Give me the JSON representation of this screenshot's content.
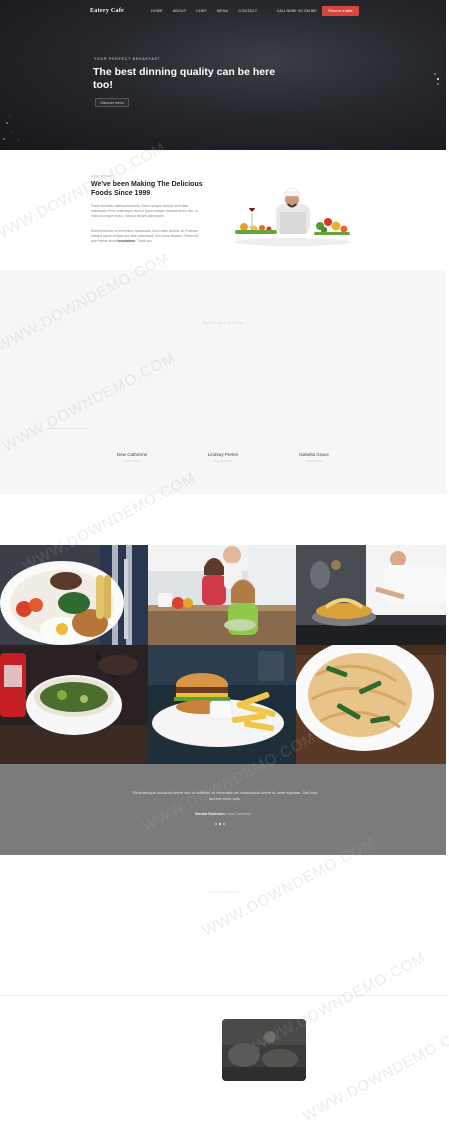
{
  "nav": {
    "logo": "Eatery Cafe",
    "items": [
      "HOME",
      "ABOUT",
      "CHEF",
      "MENU",
      "CONTACT"
    ],
    "call": "CALL NOW! +01 234 567",
    "reserve_label": "Reserve a table"
  },
  "hero": {
    "kicker": "YOUR PERFECT BREAKFAST",
    "title": "The best dinning quality can be here too!",
    "button_label": "Discover menu"
  },
  "about": {
    "kicker": "OUR STORY",
    "title": "We've been Making The Delicious Foods Since 1999",
    "paragraph_1": "Fusce hendrerit malesuada lacinia. Donec semper semper sem vitae malesuada. Proin scelerisque risus et ipsum semper molestie sed in nisi. Ut rhoncus congue lectus, rhoncus dictum ullamcorper.",
    "paragraph_2": "Sed elementum an fermentum malesuada. Nunc ullam at dolor sit. Praesent tristique sapien tempus sed felis scelerisque. Vel cursus aliquam. Please tell your friends about",
    "brand_link": "templatemo",
    "paragraph_end": ". Thank you."
  },
  "team": {
    "heading": "Meet our chefs",
    "members": [
      {
        "name": "New Catherine",
        "role": "Sushi Chef"
      },
      {
        "name": "Lindsay Perlen",
        "role": "Pastry Chef"
      },
      {
        "name": "Isabella Grace",
        "role": "Head Chef"
      }
    ]
  },
  "testimonial": {
    "quote": "Pellentesque tincidunt lorem sed ut eleifend at venenatis vel malesuada lorem id, ante egestas. Sed sed laoreet dolor quis.",
    "author": "Sandra Robinson",
    "author_role": "Loyal Customer"
  },
  "lower": {
    "kicker": "OUR LATEST"
  },
  "watermark": "WWW.DOWNDEMO.COM",
  "colors": {
    "accent": "#d6463f",
    "hero_bg": "#25272d",
    "testimonial_bg": "#7b7b7b",
    "team_bg": "#f6f6f6"
  }
}
